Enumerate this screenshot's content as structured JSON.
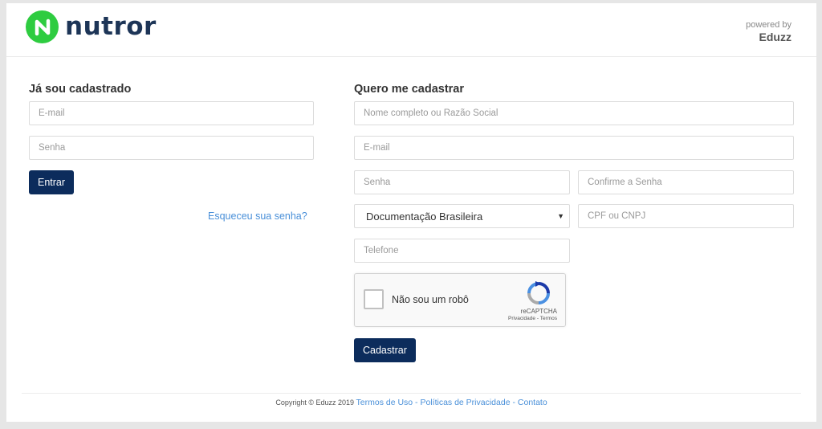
{
  "header": {
    "logo_text": "nutror",
    "powered_label": "powered by",
    "powered_brand": "Eduzz"
  },
  "login": {
    "heading": "Já sou cadastrado",
    "email_placeholder": "E-mail",
    "password_placeholder": "Senha",
    "submit_label": "Entrar",
    "forgot_link": "Esqueceu sua senha?"
  },
  "register": {
    "heading": "Quero me cadastrar",
    "name_placeholder": "Nome completo ou Razão Social",
    "email_placeholder": "E-mail",
    "password_placeholder": "Senha",
    "confirm_placeholder": "Confirme a Senha",
    "document_type_selected": "Documentação Brasileira",
    "cpf_placeholder": "CPF ou CNPJ",
    "phone_placeholder": "Telefone",
    "captcha": {
      "label": "Não sou um robô",
      "brand": "reCAPTCHA",
      "privacy": "Privacidade",
      "separator": " - ",
      "terms": "Termos"
    },
    "submit_label": "Cadastrar"
  },
  "footer": {
    "copyright": "Copyright © Eduzz 2019",
    "terms_link": "Termos de Uso",
    "privacy_link": "Políticas de Privacidade",
    "contact_link": "Contato",
    "separator": " - "
  },
  "colors": {
    "accent": "#0c2c5c",
    "logo_green": "#2ecc40",
    "link": "#4a90d9"
  },
  "icons": [
    "logo-n-icon",
    "chevron-down-icon",
    "recaptcha-icon"
  ]
}
